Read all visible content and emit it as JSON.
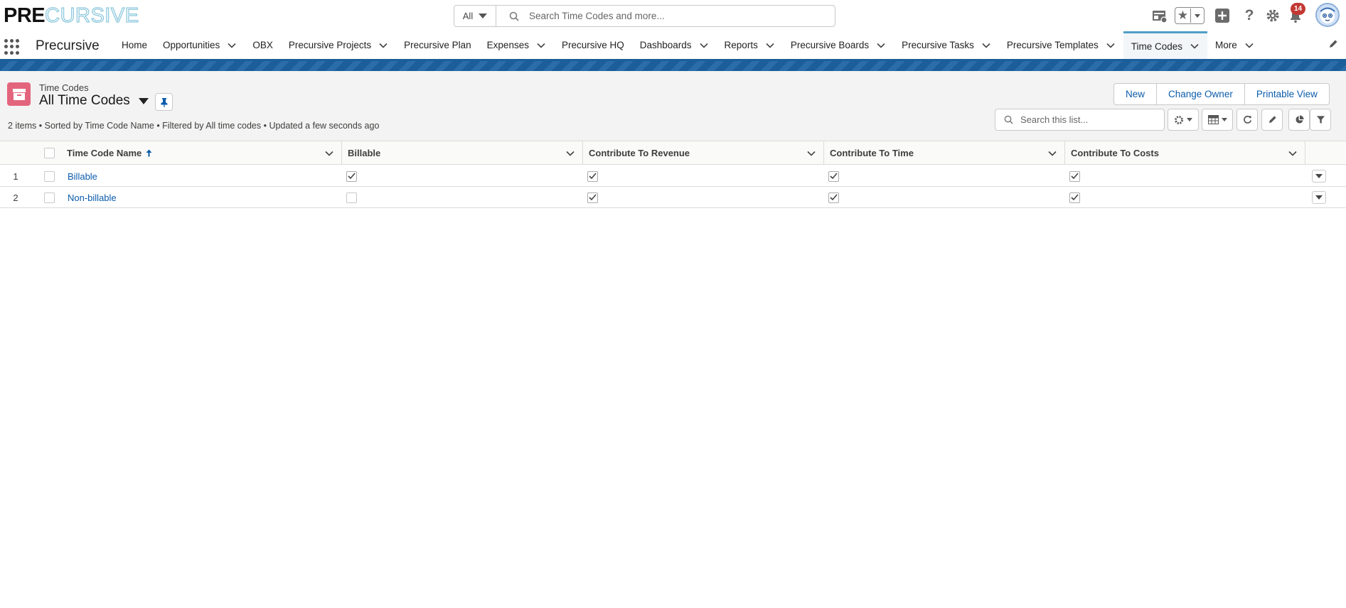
{
  "header": {
    "logo_bold": "PRE",
    "logo_outline": "CURSIVE",
    "search_scope": "All",
    "search_placeholder": "Search Time Codes and more...",
    "notification_count": "14"
  },
  "nav": {
    "app_name": "Precursive",
    "items": [
      {
        "label": "Home",
        "has_menu": false
      },
      {
        "label": "Opportunities",
        "has_menu": true
      },
      {
        "label": "OBX",
        "has_menu": false
      },
      {
        "label": "Precursive Projects",
        "has_menu": true
      },
      {
        "label": "Precursive Plan",
        "has_menu": false
      },
      {
        "label": "Expenses",
        "has_menu": true
      },
      {
        "label": "Precursive HQ",
        "has_menu": false
      },
      {
        "label": "Dashboards",
        "has_menu": true
      },
      {
        "label": "Reports",
        "has_menu": true
      },
      {
        "label": "Precursive Boards",
        "has_menu": true
      },
      {
        "label": "Precursive Tasks",
        "has_menu": true
      },
      {
        "label": "Precursive Templates",
        "has_menu": true
      },
      {
        "label": "Time Codes",
        "has_menu": true,
        "active": true
      },
      {
        "label": "More",
        "has_menu": true
      }
    ]
  },
  "list_view": {
    "object_label": "Time Codes",
    "view_name": "All Time Codes",
    "meta": "2 items • Sorted by Time Code Name • Filtered by All time codes • Updated a few seconds ago",
    "buttons": {
      "new": "New",
      "change_owner": "Change Owner",
      "printable_view": "Printable View"
    },
    "search_placeholder": "Search this list..."
  },
  "table": {
    "columns": [
      "Time Code Name",
      "Billable",
      "Contribute To Revenue",
      "Contribute To Time",
      "Contribute To Costs"
    ],
    "rows": [
      {
        "num": "1",
        "name": "Billable",
        "billable": true,
        "revenue": true,
        "time": true,
        "costs": true
      },
      {
        "num": "2",
        "name": "Non-billable",
        "billable": false,
        "revenue": true,
        "time": true,
        "costs": true
      }
    ]
  },
  "colors": {
    "brand_blue": "#1b5e9a",
    "link": "#0b5cab",
    "object_icon": "#e3657d",
    "badge": "#c23934"
  }
}
